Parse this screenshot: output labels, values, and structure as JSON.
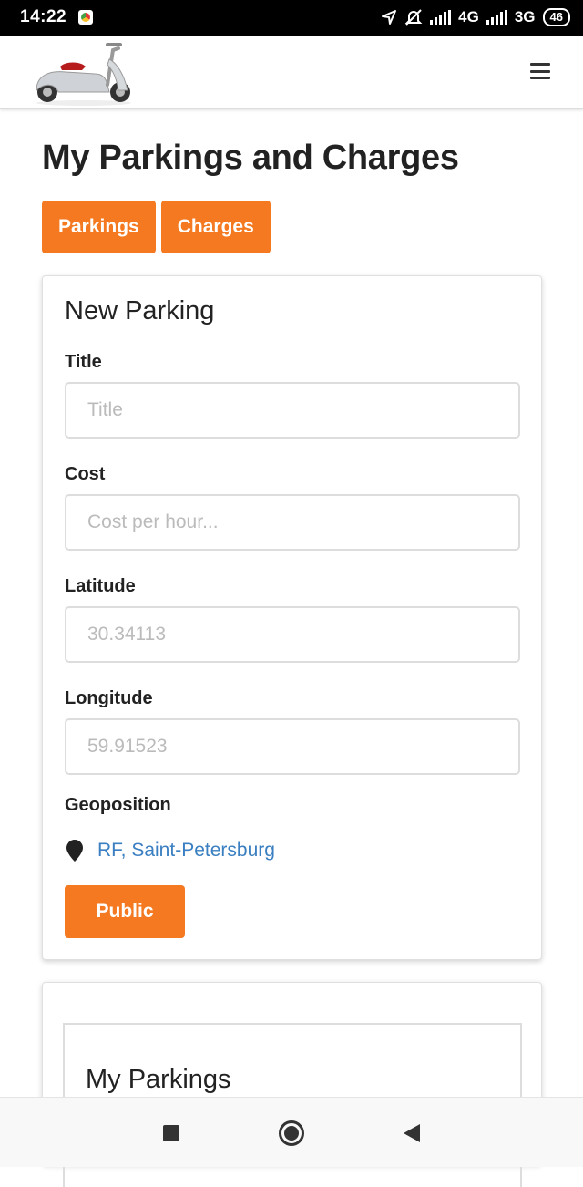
{
  "status_bar": {
    "time": "14:22",
    "network_1": "4G",
    "network_2": "3G",
    "battery": "46"
  },
  "header": {
    "logo_icon": "scooter-logo",
    "menu_icon": "hamburger-menu-icon"
  },
  "page": {
    "title": "My Parkings and Charges",
    "tabs": [
      {
        "label": "Parkings"
      },
      {
        "label": "Charges"
      }
    ]
  },
  "new_parking": {
    "title": "New Parking",
    "fields": [
      {
        "label": "Title",
        "placeholder": "Title"
      },
      {
        "label": "Cost",
        "placeholder": "Cost per hour..."
      },
      {
        "label": "Latitude",
        "placeholder": "30.34113"
      },
      {
        "label": "Longitude",
        "placeholder": "59.91523"
      }
    ],
    "geoposition_label": "Geoposition",
    "geoposition_value": "RF, Saint-Petersburg",
    "submit_label": "Public"
  },
  "my_parkings": {
    "title": "My Parkings"
  },
  "colors": {
    "accent": "#f47920",
    "link": "#3a7fc1"
  }
}
